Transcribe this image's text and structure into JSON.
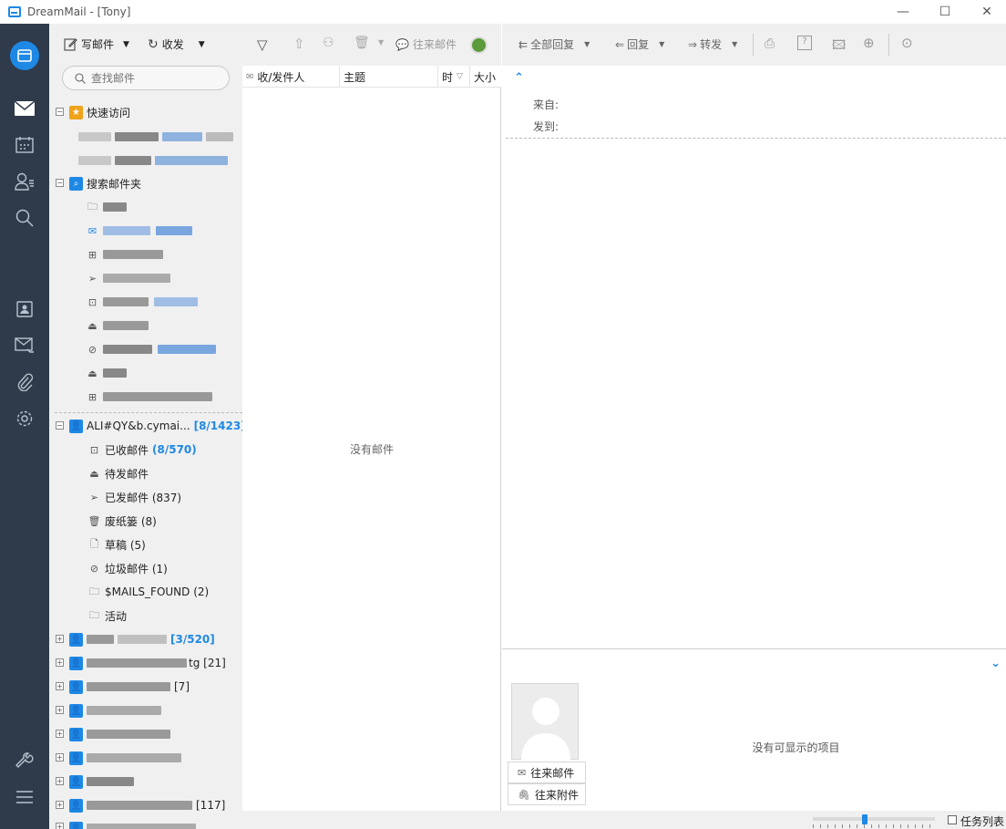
{
  "window": {
    "title": "DreamMail - [Tony]",
    "minimize": "—",
    "maximize": "☐",
    "close": "✕"
  },
  "rail": {
    "icons": [
      "mail-logo-icon",
      "mail-icon",
      "calendar-icon",
      "contacts-icon",
      "search-icon",
      "contact-card-icon",
      "mail-filter-icon",
      "attachment-icon",
      "settings-icon",
      "wrench-icon",
      "menu-icon"
    ]
  },
  "folder_toolbar": {
    "compose": "写邮件",
    "sync": "收发"
  },
  "search": {
    "placeholder": "查找邮件"
  },
  "tree": {
    "quick_access": "快速访问",
    "search_folders": "搜索邮件夹",
    "account": {
      "name": "ALI#QY&b.cymai...",
      "count": "[8/1423]"
    },
    "folders": [
      {
        "label": "已收邮件",
        "count": "(8/570)",
        "icon": "inbox-icon"
      },
      {
        "label": "待发邮件",
        "count": "",
        "icon": "outbox-icon"
      },
      {
        "label": "已发邮件 (837)",
        "count": "",
        "icon": "sent-icon"
      },
      {
        "label": "废纸篓 (8)",
        "count": "",
        "icon": "trash-icon"
      },
      {
        "label": "草稿 (5)",
        "count": "",
        "icon": "draft-icon"
      },
      {
        "label": "垃圾邮件 (1)",
        "count": "",
        "icon": "spam-icon"
      },
      {
        "label": "$MAILS_FOUND (2)",
        "count": "",
        "icon": "folder-icon"
      },
      {
        "label": "活动",
        "count": "",
        "icon": "folder-icon"
      }
    ],
    "other_accounts": [
      {
        "count": "[3/520]"
      },
      {
        "count": "tg [21]"
      },
      {
        "count": "[7]"
      },
      {
        "count": ""
      },
      {
        "count": ""
      },
      {
        "count": ""
      },
      {
        "count": ""
      },
      {
        "count": "[117]"
      }
    ]
  },
  "mail_list": {
    "toolbar": {
      "correspondence": "往来邮件"
    },
    "columns": [
      "收/发件人",
      "主题",
      "时",
      "大小"
    ],
    "empty": "没有邮件"
  },
  "reader": {
    "toolbar": {
      "reply_all": "全部回复",
      "reply": "回复",
      "forward": "转发"
    },
    "from_label": "来自:",
    "to_label": "发到:",
    "bottom": {
      "tab_mail": "往来邮件",
      "tab_attach": "往来附件",
      "empty": "没有可显示的项目"
    }
  },
  "status": {
    "task_list": "任务列表"
  }
}
